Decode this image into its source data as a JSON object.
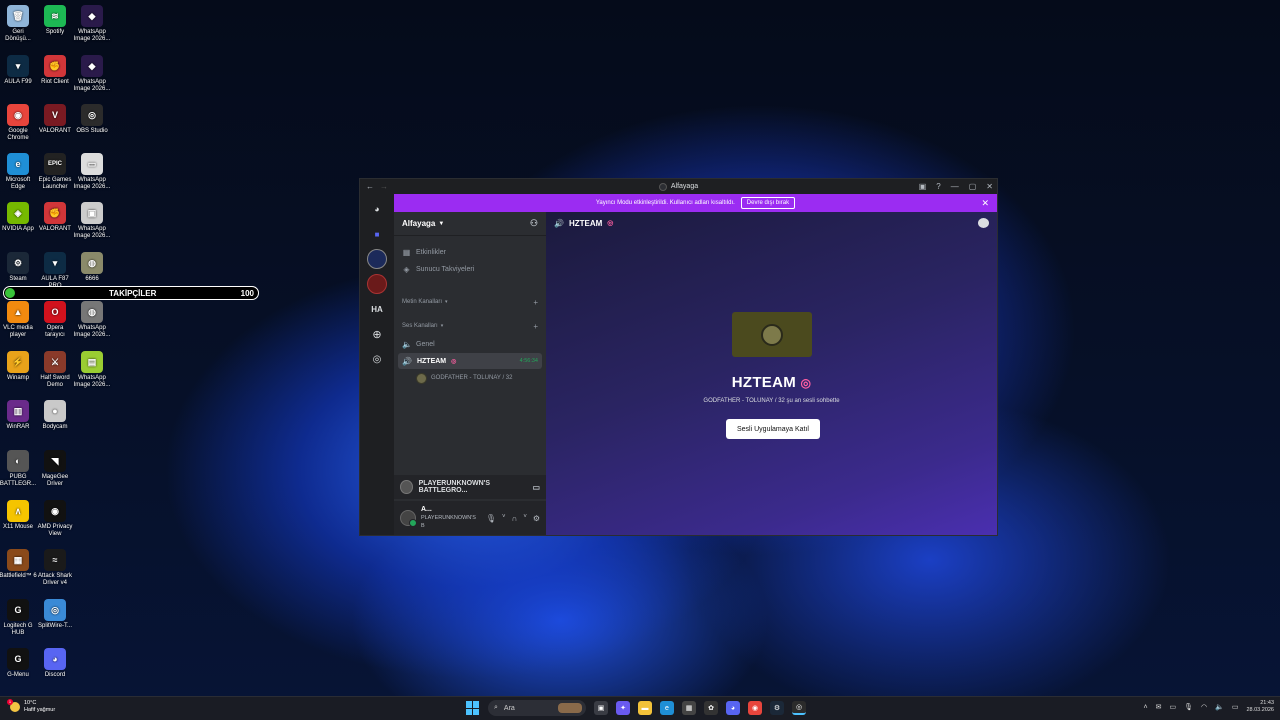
{
  "desktop_icons": [
    {
      "label": "Geri\nDönüşü...",
      "icon": "recycle-bin-icon",
      "color": "#8fb5d9",
      "glyph": "🗑"
    },
    {
      "label": "Spotify",
      "icon": "spotify-icon",
      "color": "#1db954",
      "glyph": "≋"
    },
    {
      "label": "WhatsApp\nImage 2026...",
      "icon": "image-file-icon",
      "color": "#2a1a4a",
      "glyph": "◆"
    },
    {
      "label": "AULA F99",
      "icon": "aula-icon",
      "color": "#0d2b44",
      "glyph": "▾"
    },
    {
      "label": "Riot Client",
      "icon": "riot-client-icon",
      "color": "#d13639",
      "glyph": "✊"
    },
    {
      "label": "WhatsApp\nImage 2026...",
      "icon": "image-file-icon",
      "color": "#2a1a4a",
      "glyph": "◆"
    },
    {
      "label": "Google\nChrome",
      "icon": "chrome-icon",
      "color": "#e8453c",
      "glyph": "◉"
    },
    {
      "label": "VALORANT",
      "icon": "valorant-icon",
      "color": "#7a1a22",
      "glyph": "V"
    },
    {
      "label": "OBS Studio",
      "icon": "obs-icon",
      "color": "#2b2b2b",
      "glyph": "◎"
    },
    {
      "label": "Microsoft\nEdge",
      "icon": "edge-icon",
      "color": "#1f8fd6",
      "glyph": "e"
    },
    {
      "label": "Epic Games\nLauncher",
      "icon": "epic-games-icon",
      "color": "#222222",
      "glyph": "EPIC"
    },
    {
      "label": "WhatsApp\nImage 2026...",
      "icon": "image-file-icon",
      "color": "#dddddd",
      "glyph": "▭"
    },
    {
      "label": "NVIDIA App",
      "icon": "nvidia-icon",
      "color": "#76b900",
      "glyph": "◈"
    },
    {
      "label": "VALORANT",
      "icon": "valorant-icon",
      "color": "#d13639",
      "glyph": "✊"
    },
    {
      "label": "WhatsApp\nImage 2026...",
      "icon": "image-file-icon",
      "color": "#cccccc",
      "glyph": "▣"
    },
    {
      "label": "Steam",
      "icon": "steam-icon",
      "color": "#1b2838",
      "glyph": "⚙"
    },
    {
      "label": "AULA F87\nPRO",
      "icon": "aula-icon",
      "color": "#0d2b44",
      "glyph": "▾"
    },
    {
      "label": "6666",
      "icon": "image-file-icon",
      "color": "#8a8a6a",
      "glyph": "◍"
    },
    {
      "label": "VLC media\nplayer",
      "icon": "vlc-icon",
      "color": "#f28a0f",
      "glyph": "▲"
    },
    {
      "label": "Opera\ntarayıcı",
      "icon": "opera-icon",
      "color": "#d1121d",
      "glyph": "O"
    },
    {
      "label": "WhatsApp\nImage 2026...",
      "icon": "image-file-icon",
      "color": "#777777",
      "glyph": "◍"
    },
    {
      "label": "Winamp",
      "icon": "winamp-icon",
      "color": "#e8a21a",
      "glyph": "⚡"
    },
    {
      "label": "Half Sword\nDemo",
      "icon": "half-sword-icon",
      "color": "#8a3a2a",
      "glyph": "⚔"
    },
    {
      "label": "WhatsApp\nImage 2026...",
      "icon": "image-file-icon",
      "color": "#9acd32",
      "glyph": "▤"
    },
    {
      "label": "WinRAR",
      "icon": "winrar-icon",
      "color": "#6a2a8a",
      "glyph": "▥"
    },
    {
      "label": "Bodycam",
      "icon": "bodycam-icon",
      "color": "#c9c9c9",
      "glyph": "●"
    },
    {
      "label": "PUBG\nBATTLEGR...",
      "icon": "pubg-icon",
      "color": "#555555",
      "glyph": "◐"
    },
    {
      "label": "MageGee\nDriver",
      "icon": "magegee-icon",
      "color": "#111111",
      "glyph": "◥"
    },
    {
      "label": "X11 Mouse",
      "icon": "x11-mouse-icon",
      "color": "#f5c400",
      "glyph": "∧"
    },
    {
      "label": "AMD Privacy\nView",
      "icon": "amd-privacy-icon",
      "color": "#111111",
      "glyph": "◉"
    },
    {
      "label": "Battlefield™ 6",
      "icon": "battlefield-icon",
      "color": "#8a4a1a",
      "glyph": "▦"
    },
    {
      "label": "Attack Shark\nDriver v4",
      "icon": "attack-shark-icon",
      "color": "#1a1a1a",
      "glyph": "≈"
    },
    {
      "label": "Logitech G\nHUB",
      "icon": "logitech-icon",
      "color": "#111111",
      "glyph": "G"
    },
    {
      "label": "SplitWire-T...",
      "icon": "splitwire-icon",
      "color": "#3a8ad6",
      "glyph": "◎"
    },
    {
      "label": "G-Menu",
      "icon": "g-menu-icon",
      "color": "#111111",
      "glyph": "G"
    },
    {
      "label": "Discord",
      "icon": "discord-icon",
      "color": "#5865f2",
      "glyph": "◕"
    }
  ],
  "followers": {
    "label": "TAKİPÇİLER",
    "count": "100",
    "progress_percent": 1
  },
  "discord": {
    "window_title": "Alfayaga",
    "banner": {
      "text": "Yayıncı Modu etkinleştirildi. Kullanıcı adları kısaltıldı.",
      "button": "Devre dışı bırak",
      "accent": "#9b2cf2"
    },
    "rail": {
      "initials": "HA"
    },
    "sidebar": {
      "server_name": "Alfayaga",
      "events": "Etkinlikler",
      "boosts": "Sunucu Takviyeleri",
      "text_category": "Metin Kanalları",
      "voice_category": "Ses Kanalları",
      "voice_channel_1": "Genel",
      "active_channel": "HZTEAM",
      "active_timer": "4:56:34",
      "voice_user": "GODFATHER - TOLUNAY / 32"
    },
    "activity": {
      "game": "PLAYERUNKNOWN'S BATTLEGRO..."
    },
    "user": {
      "name": "A...",
      "status": "PLAYERUNKNOWN'S B"
    },
    "main": {
      "channel_title": "HZTEAM",
      "big_title": "HZTEAM",
      "subtitle": "GODFATHER - TOLUNAY / 32 şu an sesli sohbette",
      "join_button": "Sesli Uygulamaya Katıl"
    }
  },
  "taskbar": {
    "temperature": "10°C",
    "weather": "Hafif yağmur",
    "search_placeholder": "Ara",
    "time": "21:43",
    "date": "28.03.2026"
  }
}
